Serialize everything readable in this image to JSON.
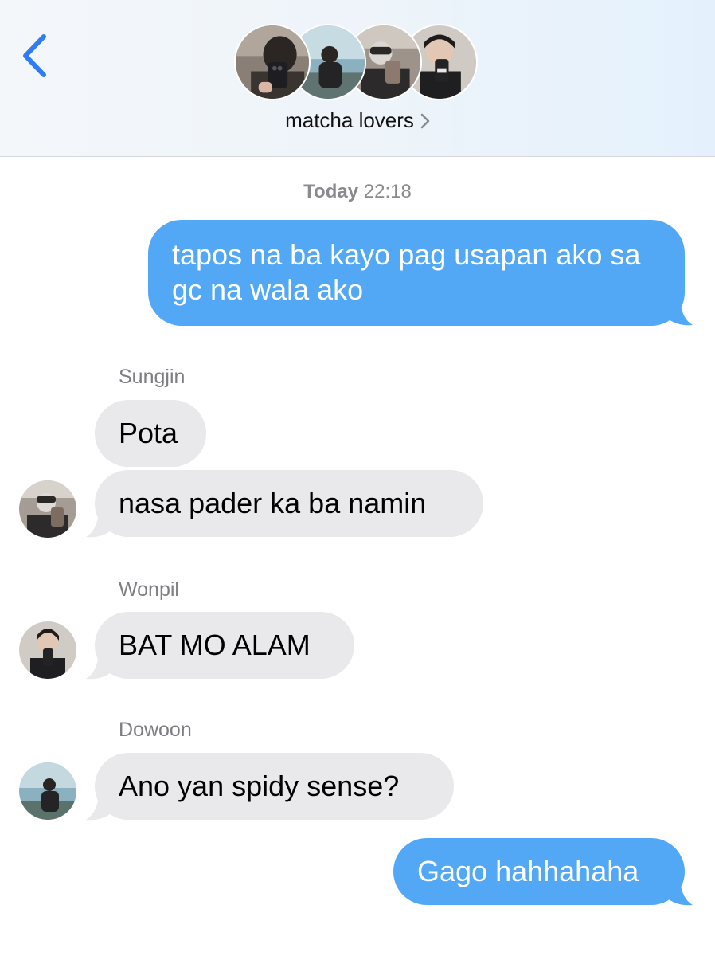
{
  "header": {
    "group_name": "matcha lovers",
    "back_icon": "chevron-left-icon",
    "group_avatars": [
      "avatar-1",
      "avatar-2",
      "avatar-3",
      "avatar-4"
    ],
    "accent_color": "#2f7cf6"
  },
  "timestamp": {
    "day": "Today",
    "time": "22:18"
  },
  "messages": [
    {
      "from": "me",
      "text": "tapos na ba kayo pag usapan ako sa gc na wala ako"
    },
    {
      "from": "Sungjin",
      "sender_label": "Sungjin",
      "text": "Pota"
    },
    {
      "from": "Sungjin",
      "text": "nasa pader ka ba namin"
    },
    {
      "from": "Wonpil",
      "sender_label": "Wonpil",
      "text": "BAT MO ALAM"
    },
    {
      "from": "Dowoon",
      "sender_label": "Dowoon",
      "text": "Ano yan spidy sense?"
    },
    {
      "from": "me",
      "text": "Gago hahhahaha"
    }
  ],
  "colors": {
    "outgoing_bubble": "#52a8f5",
    "incoming_bubble": "#e9e9eb",
    "secondary_text": "#8a8a8e"
  }
}
